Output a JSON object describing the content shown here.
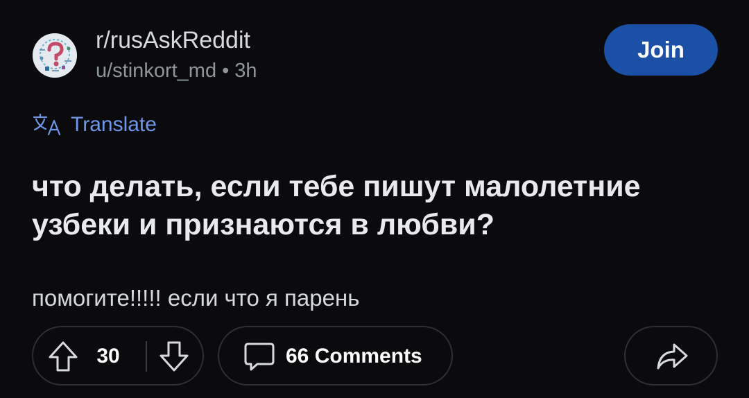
{
  "post_header": {
    "subreddit": "r/rusAskReddit",
    "author": "u/stinkort_md",
    "separator": "•",
    "time_ago": "3h",
    "join_label": "Join",
    "avatar_icon": "subreddit-avatar-question-mark"
  },
  "translate": {
    "label": "Translate",
    "icon": "translate-icon",
    "color": "#6f96e8"
  },
  "post": {
    "title": "что делать, если тебе пишут малолетние узбеки и признаются в любви?",
    "body": "помогите!!!!! если что я парень"
  },
  "actions": {
    "upvote_icon": "arrow-up-icon",
    "vote_count": "30",
    "downvote_icon": "arrow-down-icon",
    "comment_icon": "comment-bubble-icon",
    "comments_label": "66 Comments",
    "share_icon": "share-arrow-icon"
  },
  "colors": {
    "background": "#0b0b0d",
    "join_button": "#1c4fa6",
    "muted_text": "#8e959b",
    "border": "#2c2f33"
  }
}
